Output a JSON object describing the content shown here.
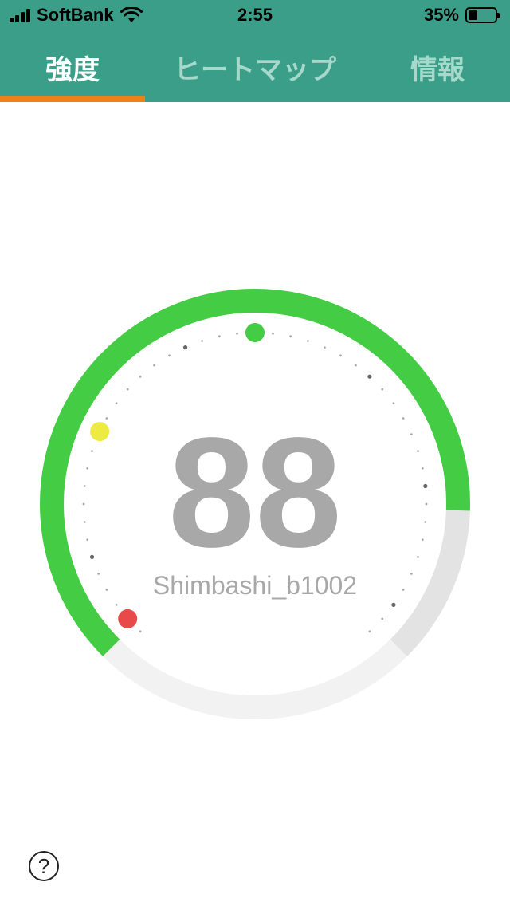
{
  "status_bar": {
    "carrier": "SoftBank",
    "time": "2:55",
    "battery_percent": "35%",
    "battery_level": 0.35
  },
  "tabs": [
    {
      "label": "強度",
      "active": true
    },
    {
      "label": "ヒートマップ",
      "active": false
    },
    {
      "label": "情報",
      "active": false
    }
  ],
  "gauge": {
    "value": "88",
    "ssid": "Shimbashi_b1002",
    "green_level": 0.84,
    "marker_colors": [
      "#44cc44",
      "#eeea44",
      "#e84a4a"
    ]
  },
  "colors": {
    "header": "#3a9e88",
    "tab_indicator": "#f28018",
    "gauge_fill": "#44cc44",
    "gauge_track": "#f2f2f2",
    "gauge_track_dark": "#e3e3e3",
    "value_text": "#a8a8a8"
  },
  "help_label": "?"
}
